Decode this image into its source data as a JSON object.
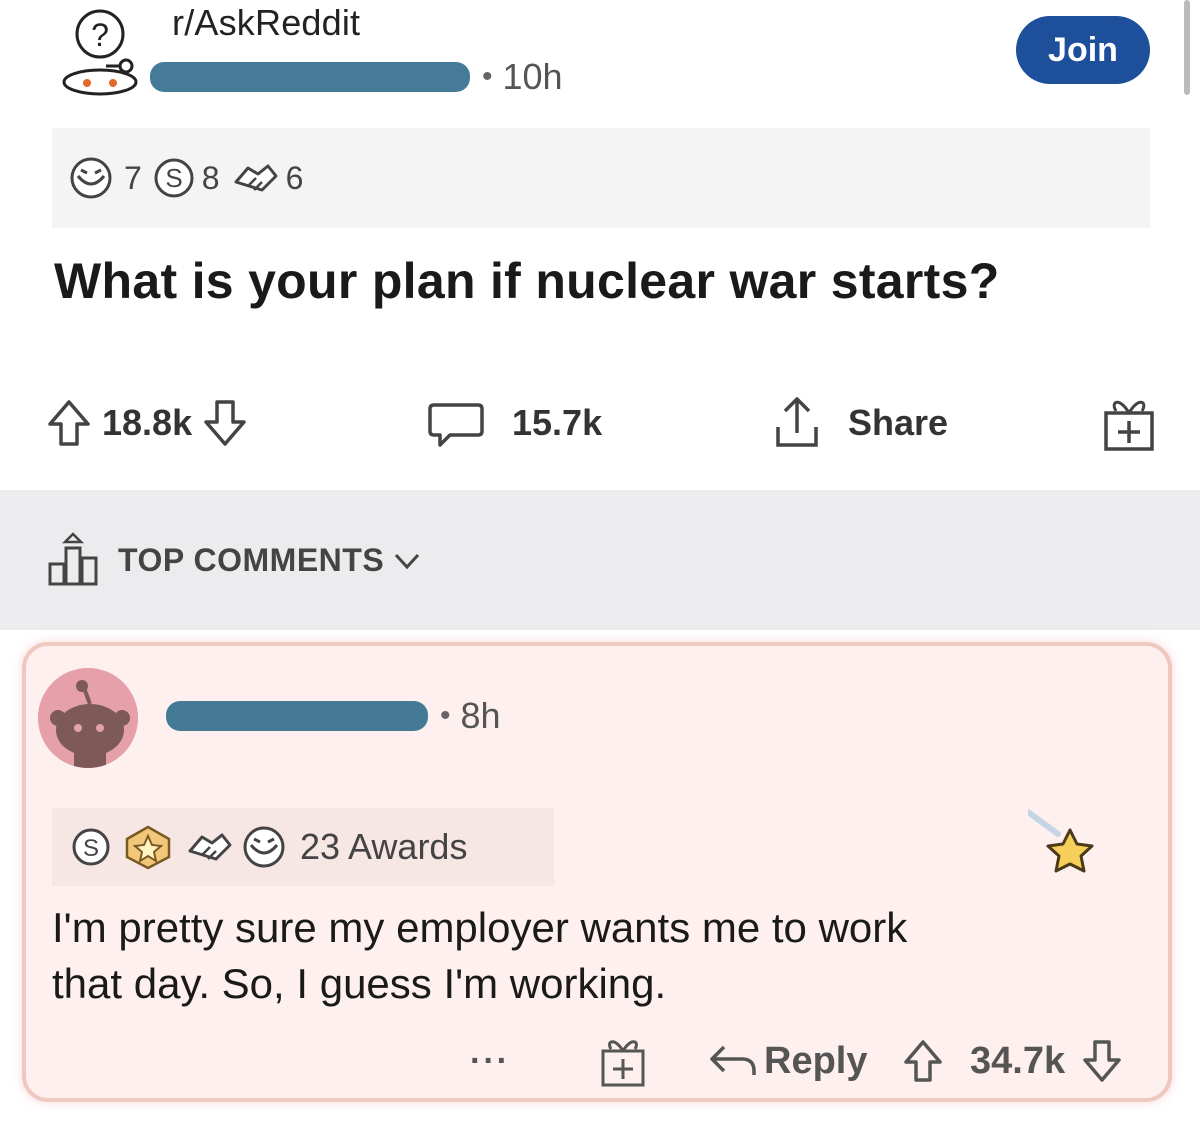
{
  "post": {
    "subreddit": "r/AskReddit",
    "time": "10h",
    "join_label": "Join",
    "awards": [
      {
        "icon": "laughing-face-award-icon",
        "count": "7"
      },
      {
        "icon": "silver-coin-award-icon",
        "count": "8"
      },
      {
        "icon": "handshake-award-icon",
        "count": "6"
      }
    ],
    "title": "What is your plan if nuclear war starts?",
    "upvotes": "18.8k",
    "comments": "15.7k",
    "share_label": "Share"
  },
  "sort": {
    "label": "TOP COMMENTS"
  },
  "comment": {
    "time": "8h",
    "awards_label": "23 Awards",
    "body_line1": "I'm pretty sure my employer wants me to work",
    "body_line2": "that day. So, I guess I'm working.",
    "more_label": "···",
    "reply_label": "Reply",
    "score": "34.7k"
  },
  "colors": {
    "join": "#1d4f9a",
    "redaction": "#35708f",
    "card_bg": "#fdf0ee",
    "card_border": "#f0c8c0"
  }
}
